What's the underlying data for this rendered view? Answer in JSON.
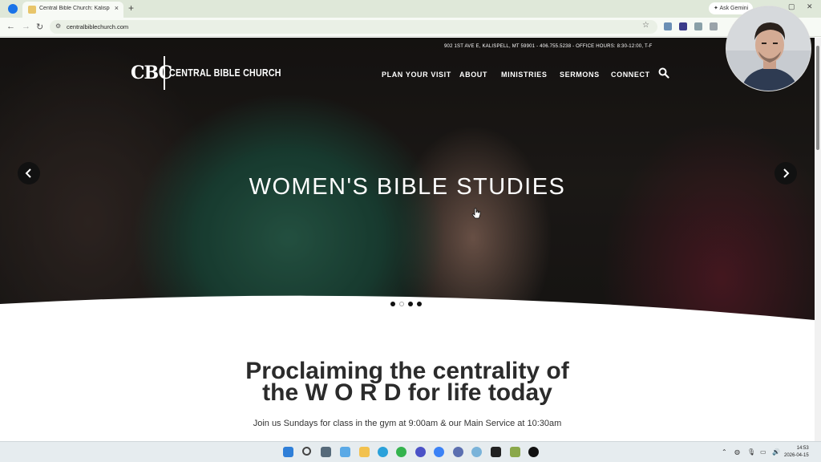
{
  "browser": {
    "tab_title": "Central Bible Church: Kalispell, I",
    "tab_close": "×",
    "new_tab": "+",
    "ask_gemini": "Ask Gemini",
    "url": "centralbiblechurch.com"
  },
  "site": {
    "top_info": "902 1ST AVE E, KALISPELL, MT 59901 - 406.755.5238 - OFFICE HOURS: 8:30-12:00, T-F",
    "logo_mark": "CBC",
    "logo_text": "CENTRAL BIBLE CHURCH",
    "nav": [
      "PLAN YOUR VISIT",
      "ABOUT",
      "MINISTRIES",
      "SERMONS",
      "CONNECT"
    ],
    "slide_title": "WOMEN'S BIBLE STUDIES",
    "slider_dots": 4,
    "active_dot": 2,
    "headline_line1": "Proclaiming the centrality of",
    "headline_line2": "the W O R D for life today",
    "subline": "Join us Sundays for class in the gym at 9:00am & our Main Service at 10:30am"
  },
  "taskbar": {
    "time": "14:53",
    "date": "2026-04-15"
  },
  "colors": {
    "nav_text": "#ffffff",
    "headline": "#2b2b2b",
    "chrome_bg": "#dfe8d9"
  }
}
